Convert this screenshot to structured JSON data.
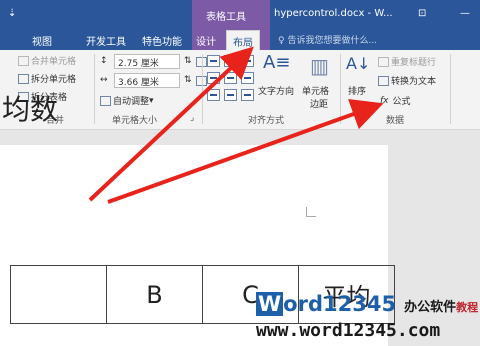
{
  "titlebar": {
    "context_label": "表格工具",
    "doc_title": "hypercontrol.docx - W..."
  },
  "tabs": {
    "view": "视图",
    "developer": "开发工具",
    "special": "特色功能",
    "design": "设计",
    "layout": "布局",
    "tell_me": "告诉我您想要做什么..."
  },
  "ribbon": {
    "merge": {
      "merge_cells": "合并单元格",
      "split_cells": "拆分单元格",
      "split_table": "拆分表格",
      "label": "合并"
    },
    "cell_size": {
      "height_value": "2.75 厘米",
      "width_value": "3.66 厘米",
      "autofit": "自动调整",
      "label": "单元格大小"
    },
    "alignment": {
      "text_direction": "文字方向",
      "cell_margins_line1": "单元格",
      "cell_margins_line2": "边距",
      "label": "对齐方式"
    },
    "data": {
      "sort": "排序",
      "repeat_header": "重复标题行",
      "convert_to_text": "转换为文本",
      "formula": "公式",
      "label": "数据"
    }
  },
  "document": {
    "title_fragment": "均数",
    "table_header": [
      "",
      "B",
      "C",
      "平均"
    ],
    "table_row2": [
      "",
      "",
      "",
      ""
    ]
  },
  "watermark": {
    "logo_word_initial": "W",
    "logo_word_rest": "ord",
    "logo_numbers": "12345",
    "logo_chinese": "办公软件",
    "logo_tutorial": "教程",
    "url": "www.word12345.com"
  },
  "colors": {
    "ribbon_blue": "#2b579a",
    "context_purple": "#7d5aa6",
    "arrow_red": "#e8231c"
  },
  "icons": [
    "merge-cells-icon",
    "split-cells-icon",
    "split-table-icon",
    "height-icon",
    "width-icon",
    "autofit-icon",
    "align-icon",
    "text-direction-icon",
    "cell-margins-icon",
    "sort-icon",
    "repeat-header-icon",
    "convert-text-icon",
    "formula-icon",
    "lightbulb-icon",
    "dialog-launcher-icon"
  ]
}
